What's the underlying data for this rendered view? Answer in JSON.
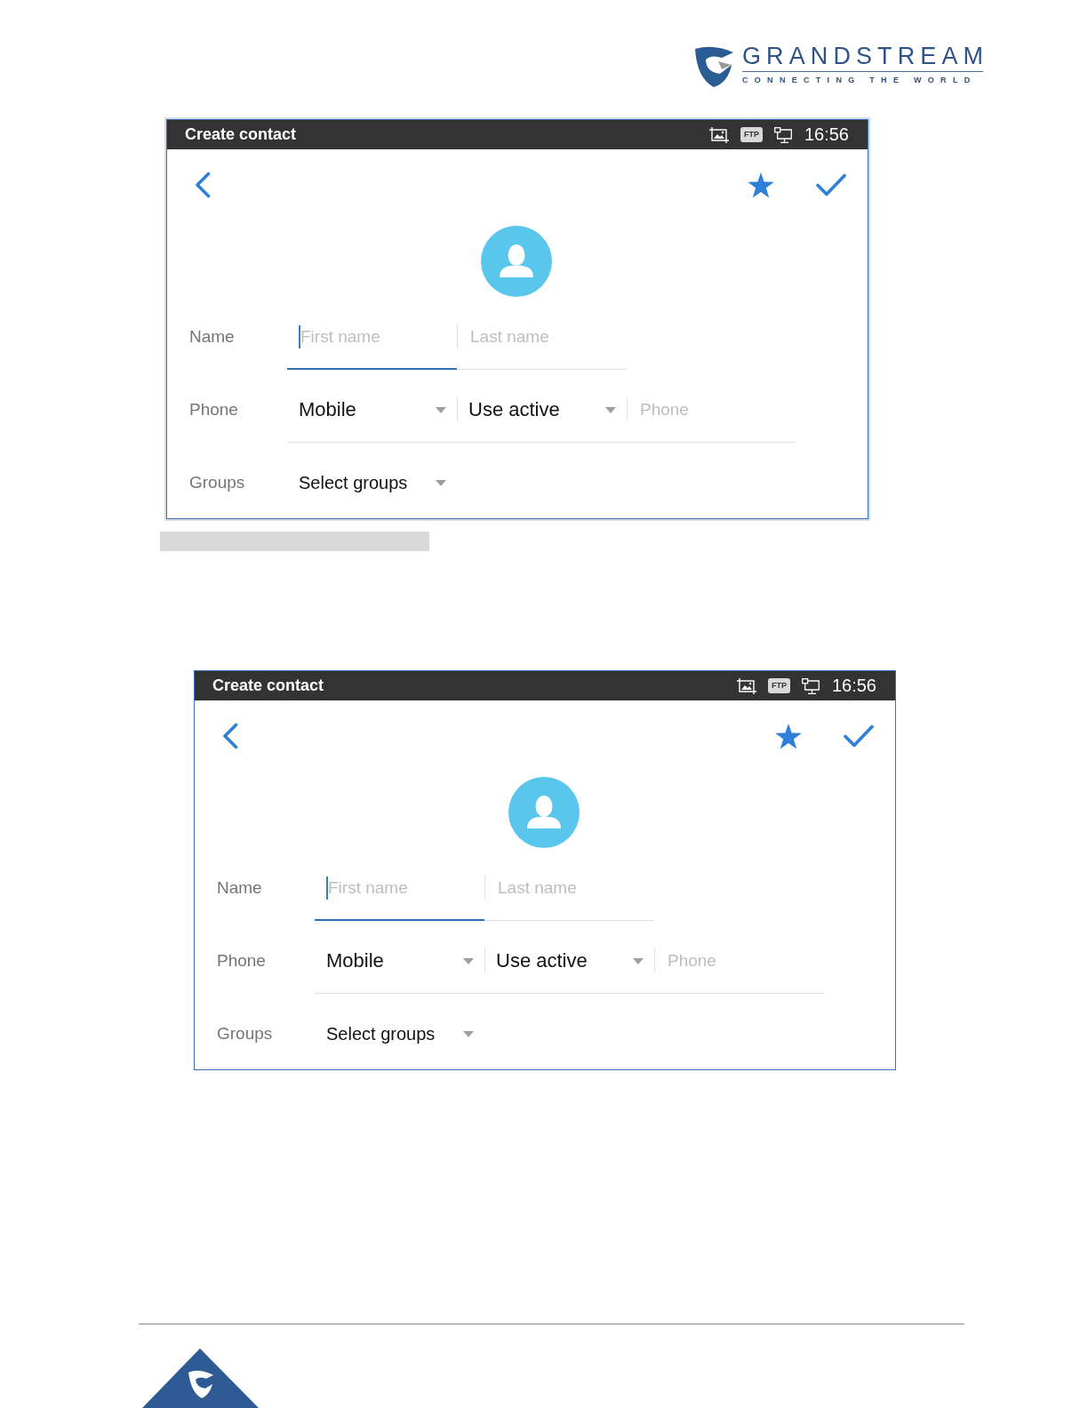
{
  "header": {
    "brand_name": "GRANDSTREAM",
    "tagline": "CONNECTING THE WORLD"
  },
  "screenshots": [
    {
      "status_bar": {
        "title": "Create contact",
        "badge": "FTP",
        "time": "16:56"
      },
      "form": {
        "rows": [
          {
            "label": "Name",
            "underlined": true,
            "controls": [
              {
                "kind": "input",
                "placeholder": "First name",
                "focused": true
              },
              {
                "kind": "input",
                "placeholder": "Last name",
                "focused": false
              }
            ]
          },
          {
            "label": "Phone",
            "underlined": true,
            "controls": [
              {
                "kind": "dropdown",
                "value": "Mobile"
              },
              {
                "kind": "dropdown",
                "value": "Use active"
              },
              {
                "kind": "input",
                "placeholder": "Phone",
                "focused": false
              }
            ]
          },
          {
            "label": "Groups",
            "underlined": false,
            "controls": [
              {
                "kind": "dropdown",
                "value": "Select groups"
              }
            ]
          }
        ]
      }
    },
    {
      "status_bar": {
        "title": "Create contact",
        "badge": "FTP",
        "time": "16:56"
      },
      "form": {
        "rows": [
          {
            "label": "Name",
            "underlined": true,
            "controls": [
              {
                "kind": "input",
                "placeholder": "First name",
                "focused": true
              },
              {
                "kind": "input",
                "placeholder": "Last name",
                "focused": false
              }
            ]
          },
          {
            "label": "Phone",
            "underlined": true,
            "controls": [
              {
                "kind": "dropdown",
                "value": "Mobile"
              },
              {
                "kind": "dropdown",
                "value": "Use active"
              },
              {
                "kind": "input",
                "placeholder": "Phone",
                "focused": false
              }
            ]
          },
          {
            "label": "Groups",
            "underlined": false,
            "controls": [
              {
                "kind": "dropdown",
                "value": "Select groups"
              }
            ]
          }
        ]
      }
    }
  ]
}
